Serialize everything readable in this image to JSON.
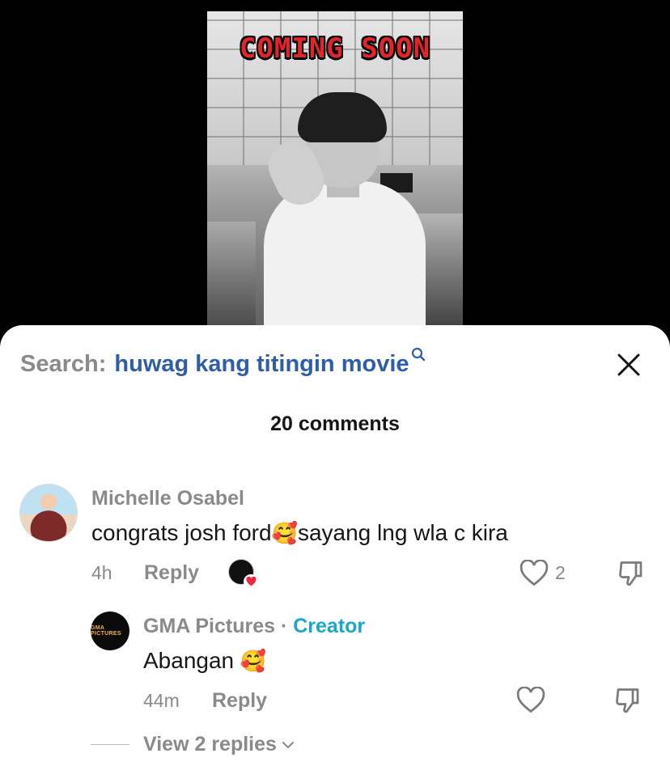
{
  "video": {
    "overlay_title": "COMING SOON"
  },
  "search": {
    "label": "Search:",
    "query": "huwag kang titingin movie"
  },
  "comments_header": {
    "count_label": "20 comments"
  },
  "comments": [
    {
      "username": "Michelle Osabel",
      "text_before": "congrats josh ford",
      "emoji": "🥰",
      "text_after": "sayang lng wla c kira",
      "time": "4h",
      "reply_label": "Reply",
      "like_count": "2",
      "liked_by_creator": true
    }
  ],
  "reply": {
    "username": "GMA Pictures",
    "separator": " · ",
    "badge": "Creator",
    "text": "Abangan ",
    "emoji": "🥰",
    "time": "44m",
    "reply_label": "Reply",
    "avatar_text": "GMA PICTURES"
  },
  "view_replies": {
    "label": "View 2 replies"
  },
  "colors": {
    "link_blue": "#2f5ea8",
    "creator_teal": "#19a8c8",
    "title_red": "#e3242b",
    "muted_gray": "#8a8a8a"
  }
}
